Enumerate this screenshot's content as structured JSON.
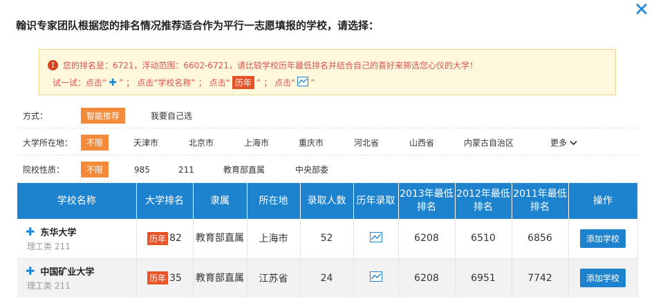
{
  "dialog": {
    "title": "翰识专家团队根据您的排名情况推荐适合作为平行一志愿填报的学校，请选择："
  },
  "notice": {
    "info_icon": "!",
    "line1": "您的排名是：6721，浮动范围：6602-6721，请比较学校历年最低排名并结合自己的喜好来筛选您心仪的大学！",
    "line2_prefix": "试一试：点击“",
    "line2_after_plus": "”",
    "sep": "；",
    "line2_click_name": "点击“学校名称”",
    "line2_click_hist_pre": "点击“",
    "hist_label": "历年",
    "line2_click_hist_post": "”",
    "line2_click_chart_pre": "点击“",
    "line2_click_chart_post": "”"
  },
  "filters": {
    "method": {
      "label": "方式：",
      "options": [
        "智能推荐",
        "我要自己选"
      ],
      "active": 0
    },
    "location": {
      "label": "大学所在地：",
      "options": [
        "不限",
        "天津市",
        "北京市",
        "上海市",
        "重庆市",
        "河北省",
        "山西省",
        "内蒙古自治区"
      ],
      "more": "更多",
      "active": 0
    },
    "type": {
      "label": "院校性质：",
      "options": [
        "不限",
        "985",
        "211",
        "教育部直属",
        "中央部委"
      ],
      "active": 0
    }
  },
  "table": {
    "headers": [
      "学校名称",
      "大学排名",
      "隶属",
      "所在地",
      "录取人数",
      "历年录取",
      "2013年最低排名",
      "2012年最低排名",
      "2011年最低排名",
      "操作"
    ],
    "rows": [
      {
        "name": "东华大学",
        "sub": "理工类  211",
        "hist": "历年",
        "rank": "82",
        "dept": "教育部直属",
        "location": "上海市",
        "admitted": "52",
        "y2013": "6208",
        "y2012": "6510",
        "y2011": "6856",
        "action": "添加学校"
      },
      {
        "name": "中国矿业大学",
        "sub": "理工类  211",
        "hist": "历年",
        "rank": "35",
        "dept": "教育部直属",
        "location": "江苏省",
        "admitted": "24",
        "y2013": "6208",
        "y2012": "6951",
        "y2011": "7742",
        "action": "添加学校"
      }
    ]
  },
  "colors": {
    "accent_blue": "#1e83cf",
    "accent_orange": "#f28a3a",
    "hist_red": "#e8542a",
    "close_blue": "#2a8ad6"
  },
  "icons": {
    "close": "close-icon",
    "info": "info-icon",
    "plus": "plus-icon",
    "chart": "line-chart-icon",
    "more": "chevron-down-icon"
  }
}
